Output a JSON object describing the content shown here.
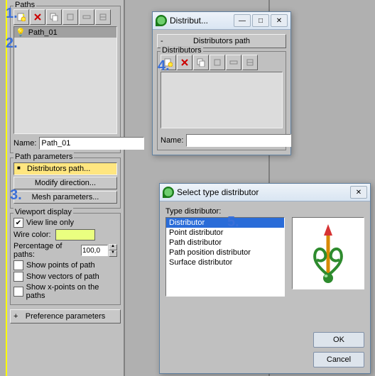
{
  "left": {
    "paths": {
      "title": "Paths",
      "items": [
        "Path_01"
      ],
      "name_label": "Name:",
      "name_value": "Path_01"
    },
    "params": {
      "title": "Path parameters",
      "btn1": "Distributors path...",
      "btn2": "Modify direction...",
      "btn3": "Mesh parameters..."
    },
    "viewport": {
      "title": "Viewport display",
      "view_line": "View line only",
      "wire_color": "Wire color:",
      "pct_label": "Percentage of paths:",
      "pct_value": "100,0",
      "show_points": "Show points of path",
      "show_vectors": "Show vectors of path",
      "show_x": "Show x-points on the paths"
    },
    "pref_rollup": "Preference parameters"
  },
  "distrib": {
    "title": "Distribut...",
    "rollup": "Distributors path",
    "group": "Distributors",
    "name_label": "Name:",
    "name_value": ""
  },
  "dialog": {
    "title": "Select type distributor",
    "type_label": "Type distributor:",
    "types": [
      "Distributor",
      "Point distributor",
      "Path distributor",
      "Path position distributor",
      "Surface distributor"
    ],
    "ok": "OK",
    "cancel": "Cancel"
  },
  "callouts": [
    "1.",
    "2.",
    "3.",
    "4.",
    "5."
  ]
}
